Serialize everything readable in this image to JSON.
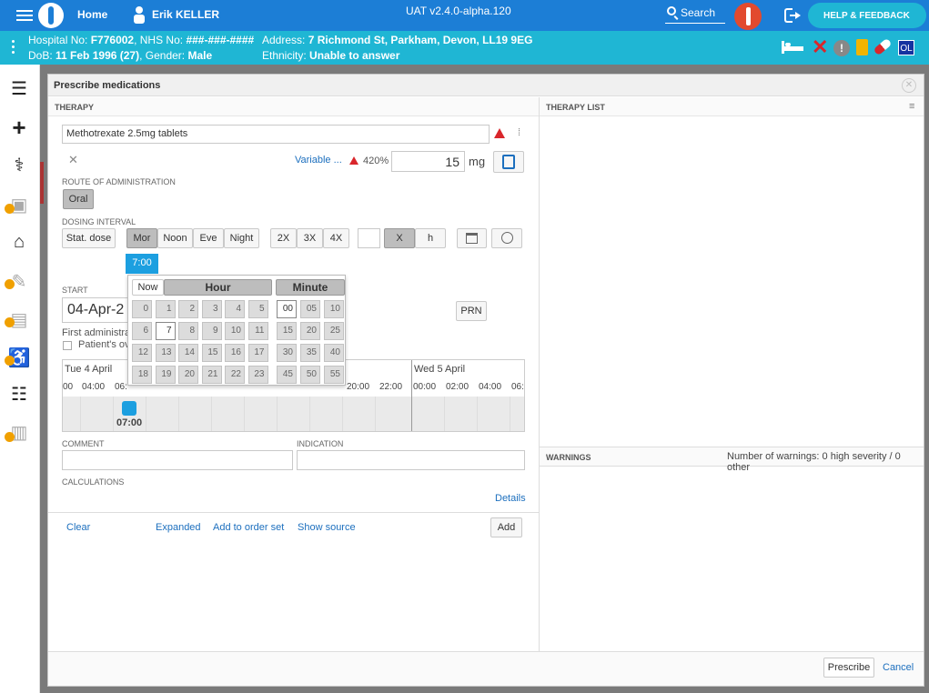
{
  "topbar": {
    "home_label": "Home",
    "user_name": "Erik KELLER",
    "env": "UAT v2.4.0-alpha.120",
    "search_label": "Search",
    "help_label": "HELP & FEEDBACK"
  },
  "patient": {
    "hospital_no_label": "Hospital No:",
    "hospital_no": "F776002",
    "nhs_label": "NHS No:",
    "nhs_no": "###-###-####",
    "address_label": "Address:",
    "address": "7 Richmond St, Parkham, Devon, LL19 9EG",
    "dob_label": "DoB:",
    "dob": "11 Feb 1996 (27)",
    "gender_label": "Gender:",
    "gender": "Male",
    "ethnicity_label": "Ethnicity:",
    "ethnicity": "Unable to answer",
    "badge": "OL"
  },
  "dialog": {
    "title": "Prescribe medications",
    "therapy_header": "THERAPY",
    "therapy_list_header": "THERAPY LIST",
    "warnings_header": "WARNINGS",
    "warnings_summary": "Number of warnings: 0 high severity / 0 other",
    "drug_name": "Methotrexate 2.5mg tablets",
    "variable_link": "Variable ...",
    "percent": "420%",
    "dose_value": "15",
    "dose_unit": "mg",
    "route_label": "ROUTE OF ADMINISTRATION",
    "route_value": "Oral",
    "dosing_label": "DOSING INTERVAL",
    "dosing_buttons": [
      "Stat. dose",
      "Mor",
      "Noon",
      "Eve",
      "Night"
    ],
    "freq_buttons": [
      "2X",
      "3X",
      "4X"
    ],
    "x_label": "X",
    "h_label": "h",
    "time_tooltip": "7:00",
    "start_label": "START",
    "start_value": "04-Apr-2",
    "first_admin": "First administra",
    "patient_own": "Patient's ov",
    "prn_label": "PRN",
    "timeline": {
      "day1": "Tue 4 April",
      "day2": "Wed 5 April",
      "hours1": [
        "00",
        "04:00",
        "06:"
      ],
      "hours_right1": [
        "20:00",
        "22:00"
      ],
      "hours2": [
        "00:00",
        "02:00",
        "04:00",
        "06:"
      ],
      "marker_time": "07:00"
    },
    "picker": {
      "now_label": "Now",
      "hour_label": "Hour",
      "minute_label": "Minute",
      "hours": [
        [
          "0",
          "1",
          "2",
          "3",
          "4",
          "5"
        ],
        [
          "6",
          "7",
          "8",
          "9",
          "10",
          "11"
        ],
        [
          "12",
          "13",
          "14",
          "15",
          "16",
          "17"
        ],
        [
          "18",
          "19",
          "20",
          "21",
          "22",
          "23"
        ]
      ],
      "minutes": [
        [
          "00",
          "05",
          "10"
        ],
        [
          "15",
          "20",
          "25"
        ],
        [
          "30",
          "35",
          "40"
        ],
        [
          "45",
          "50",
          "55"
        ]
      ],
      "selected_hour": "7",
      "selected_minute": "00"
    },
    "comment_label": "COMMENT",
    "indication_label": "INDICATION",
    "calculations_label": "CALCULATIONS",
    "details_link": "Details",
    "footer_links": {
      "clear": "Clear",
      "expanded": "Expanded",
      "add_to_order_set": "Add to order set",
      "show_source": "Show source"
    },
    "add_label": "Add",
    "prescribe_label": "Prescribe",
    "cancel_label": "Cancel"
  },
  "colors": {
    "topbar": "#1c7ed6",
    "banner": "#1fb6d4",
    "accent": "#1c9fe0",
    "warning": "#d9262b",
    "lock": "#f0a000"
  }
}
